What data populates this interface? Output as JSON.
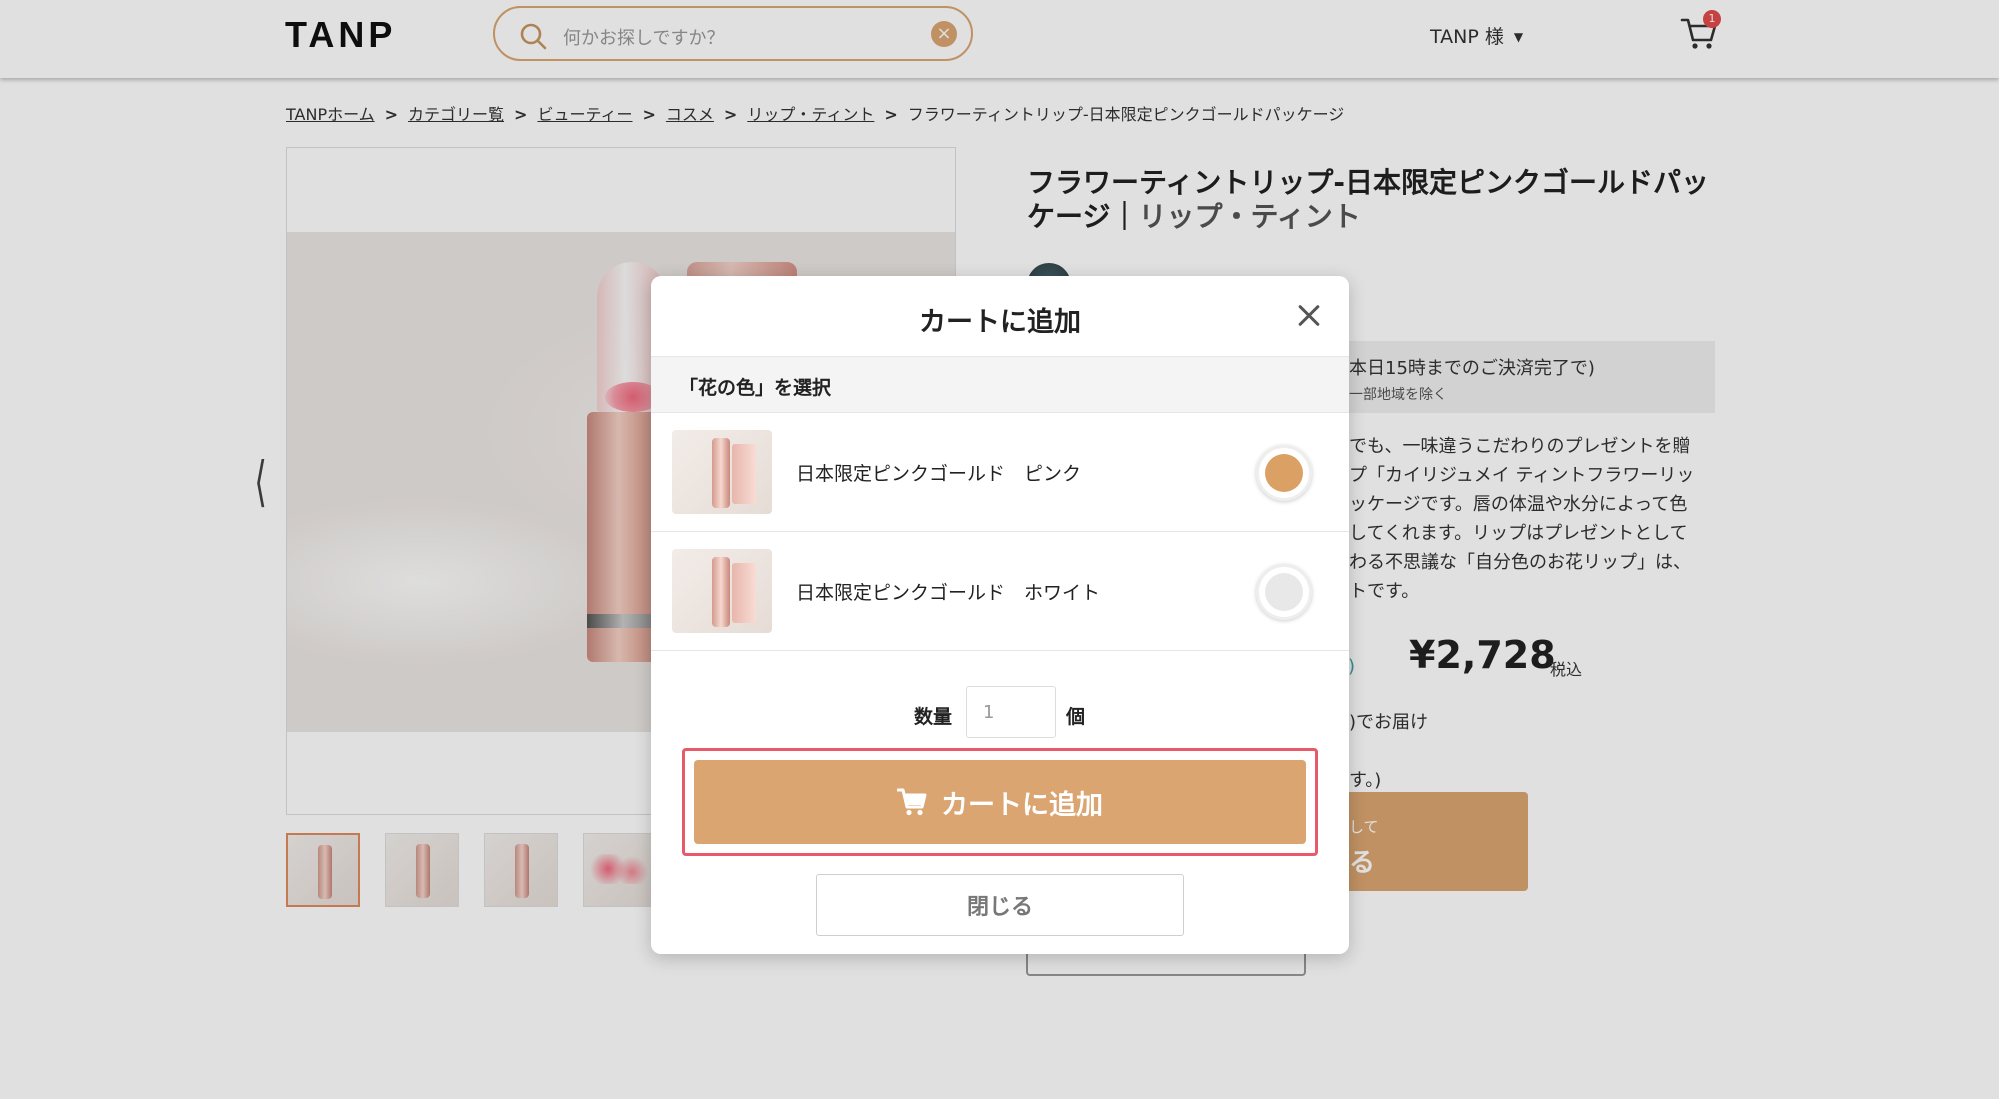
{
  "header": {
    "logo": "TANP",
    "search_placeholder": "何かお探しですか？",
    "user_label": "TANP 様",
    "cart_count": "1"
  },
  "breadcrumb": [
    "TANPホーム",
    "カテゴリー覧",
    "ビューティー",
    "コスメ",
    "リップ・ティント",
    "フラワーティントリップ-日本限定ピンクゴールドパッケージ"
  ],
  "product": {
    "title": "フラワーティントリップ-日本限定ピンクゴールドパッケージ",
    "category": "リップ・ティント",
    "ship_line1": "本日15時までのご決済完了で)",
    "ship_line2": "一部地域を除く",
    "description": "でも、一味違うこだわりのプレゼントを贈 プ「カイリジュメイ ティントフラワーリッ ッケージです。唇の体温や水分によって色 してくれます。リップはプレゼントとして わる不思議な「自分色のお花リップ」は、 トです。",
    "price_hint": "料)",
    "price": "¥2,728",
    "price_tax": "税込",
    "deliver": ")でお届け",
    "note": "す。)",
    "gift_line1": "して",
    "gift_line2": "る"
  },
  "modal": {
    "title": "カートに追加",
    "section_label": "「花の色」を選択",
    "options": [
      {
        "label": "日本限定ピンクゴールド　ピンク",
        "color": "#dba064",
        "selected": true
      },
      {
        "label": "日本限定ピンクゴールド　ホワイト",
        "color": "#e8e8e8",
        "selected": false
      }
    ],
    "quantity_label": "数量",
    "quantity_value": "1",
    "quantity_unit": "個",
    "add_button_label": "カートに追加",
    "close_button_label": "閉じる"
  },
  "colors": {
    "accent": "#dba571",
    "highlight": "#e65a6b",
    "badge": "#e24a4a"
  }
}
